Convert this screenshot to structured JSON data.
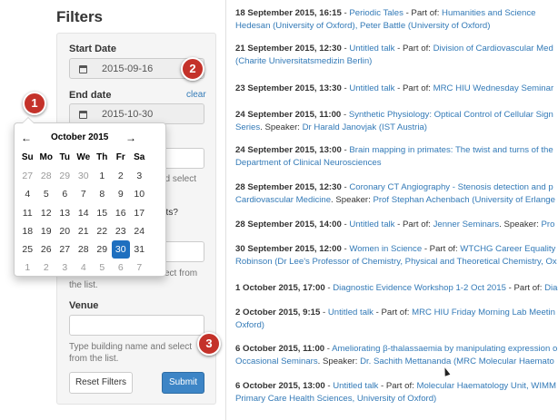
{
  "filters": {
    "title": "Filters",
    "start_label": "Start Date",
    "start_value": "2015-09-16",
    "end_label": "End date",
    "end_value": "2015-10-30",
    "clear_label": "clear",
    "series_help_fragment": "nd select",
    "topic_fragment": "nts?",
    "people_help_fragment": "ect from",
    "people_help_tail": "the list.",
    "venue_label": "Venue",
    "venue_help": "Type building name and select from the list.",
    "reset_label": "Reset Filters",
    "submit_label": "Submit"
  },
  "calendar": {
    "prev": "←",
    "next": "→",
    "month": "October 2015",
    "weekdays": [
      "Su",
      "Mo",
      "Tu",
      "We",
      "Th",
      "Fr",
      "Sa"
    ],
    "days": [
      "27",
      "28",
      "29",
      "30",
      "1",
      "2",
      "3",
      "4",
      "5",
      "6",
      "7",
      "8",
      "9",
      "10",
      "11",
      "12",
      "13",
      "14",
      "15",
      "16",
      "17",
      "18",
      "19",
      "20",
      "21",
      "22",
      "23",
      "24",
      "25",
      "26",
      "27",
      "28",
      "29",
      "30",
      "31",
      "1",
      "2",
      "3",
      "4",
      "5",
      "6",
      "7"
    ],
    "selected": "30"
  },
  "events": [
    {
      "date": "18 September 2015, 16:15",
      "title": "Periodic Tales",
      "partof": "Humanities and Science",
      "line2": "Hedesan (University of Oxford), Peter Battle (University of Oxford)"
    },
    {
      "date": "21 September 2015, 12:30",
      "title": "Untitled talk",
      "partof": "Division of Cardiovascular Med",
      "line2": "(Charite Universitatsmedizin Berlin)"
    },
    {
      "date": "23 September 2015, 13:30",
      "title": "Untitled talk",
      "partof": "MRC HIU Wednesday Seminar",
      "line2": ""
    },
    {
      "date": "24 September 2015, 11:00",
      "title": "Synthetic Physiology: Optical Control of Cellular Sign",
      "partof": "",
      "line2a": "Series",
      "line2b": "Dr Harald Janovjak (IST Austria)"
    },
    {
      "date": "24 September 2015, 13:00",
      "title": "Brain mapping in primates: The twist and turns of the",
      "partof": "",
      "line2": "Department of Clinical Neurosciences"
    },
    {
      "date": "28 September 2015, 12:30",
      "title": "Coronary CT Angiography - Stenosis detection and p",
      "partof": "",
      "line2a": "Cardiovascular Medicine",
      "line2b": "Prof Stephan Achenbach (University of Erlange"
    },
    {
      "date": "28 September 2015, 14:00",
      "title": "Untitled talk",
      "partof": "Jenner Seminars",
      "speaker": "Pro"
    },
    {
      "date": "30 September 2015, 12:00",
      "title": "Women in Science",
      "partof": "WTCHG Career Equality",
      "line2": "Robinson (Dr Lee's Professor of Chemistry, Physical and Theoretical Chemistry, Ox"
    },
    {
      "date": "1 October 2015, 17:00",
      "title": "Diagnostic Evidence Workshop 1-2 Oct 2015",
      "partof": "Diagnostic Ev"
    },
    {
      "date": "2 October 2015, 9:15",
      "title": "Untitled talk",
      "partof": "MRC HIU Friday Morning Lab Meetin",
      "line2": "Oxford)"
    },
    {
      "date": "6 October 2015, 11:00",
      "title": "Ameliorating β-thalassaemia by manipulating expression o",
      "partof": "",
      "line2a": "Occasional Seminars",
      "line2b": "Dr. Sachith Mettananda (MRC Molecular Haemato"
    },
    {
      "date": "6 October 2015, 13:00",
      "title": "Untitled talk",
      "partof": "Molecular Haematology Unit, WIMM",
      "line2": "Primary Care Health Sciences, University of Oxford)"
    }
  ],
  "text": {
    "dash": " - ",
    "partof": " - Part of: ",
    "speaker": ". Speaker: "
  },
  "callouts": [
    "1",
    "2",
    "3"
  ]
}
